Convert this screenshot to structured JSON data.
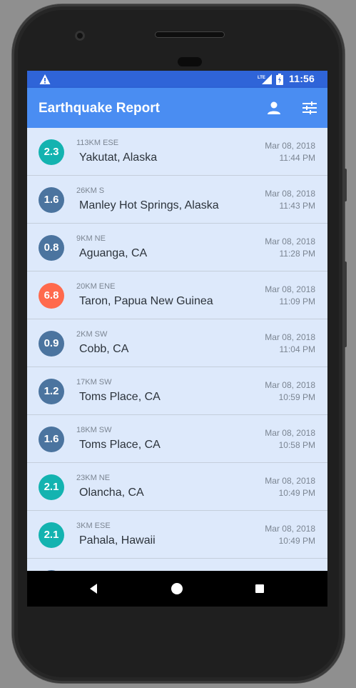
{
  "status_bar": {
    "time": "11:56",
    "network_label": "LTE",
    "icons": [
      "warning-icon",
      "signal-icon",
      "battery-icon"
    ]
  },
  "app_bar": {
    "title": "Earthquake Report",
    "icons": [
      "person-icon",
      "filter-icon"
    ],
    "color": "#4a8df2"
  },
  "colors": {
    "status_bar": "#2f64d8",
    "list_background": "#dde9fb",
    "magnitude_low": "#4b749f",
    "magnitude_teal": "#13b3b0",
    "magnitude_high": "#ff6a4d"
  },
  "earthquakes": [
    {
      "magnitude": "2.3",
      "color": "#13b3b0",
      "offset": "113KM ESE",
      "place": "Yakutat, Alaska",
      "date": "Mar 08, 2018",
      "time": "11:44 PM"
    },
    {
      "magnitude": "1.6",
      "color": "#4b749f",
      "offset": "26KM S",
      "place": "Manley Hot Springs, Alaska",
      "date": "Mar 08, 2018",
      "time": "11:43 PM"
    },
    {
      "magnitude": "0.8",
      "color": "#4b749f",
      "offset": "9KM NE",
      "place": "Aguanga, CA",
      "date": "Mar 08, 2018",
      "time": "11:28 PM"
    },
    {
      "magnitude": "6.8",
      "color": "#ff6a4d",
      "offset": "20KM ENE",
      "place": "Taron, Papua New Guinea",
      "date": "Mar 08, 2018",
      "time": "11:09 PM"
    },
    {
      "magnitude": "0.9",
      "color": "#4b749f",
      "offset": "2KM SW",
      "place": "Cobb, CA",
      "date": "Mar 08, 2018",
      "time": "11:04 PM"
    },
    {
      "magnitude": "1.2",
      "color": "#4b749f",
      "offset": "17KM SW",
      "place": "Toms Place, CA",
      "date": "Mar 08, 2018",
      "time": "10:59 PM"
    },
    {
      "magnitude": "1.6",
      "color": "#4b749f",
      "offset": "18KM SW",
      "place": "Toms Place, CA",
      "date": "Mar 08, 2018",
      "time": "10:58 PM"
    },
    {
      "magnitude": "2.1",
      "color": "#13b3b0",
      "offset": "23KM NE",
      "place": "Olancha, CA",
      "date": "Mar 08, 2018",
      "time": "10:49 PM"
    },
    {
      "magnitude": "2.1",
      "color": "#13b3b0",
      "offset": "3KM ESE",
      "place": "Pahala, Hawaii",
      "date": "Mar 08, 2018",
      "time": "10:49 PM"
    }
  ],
  "nav_bar": {
    "icons": [
      "back-icon",
      "home-icon",
      "recents-icon"
    ]
  }
}
